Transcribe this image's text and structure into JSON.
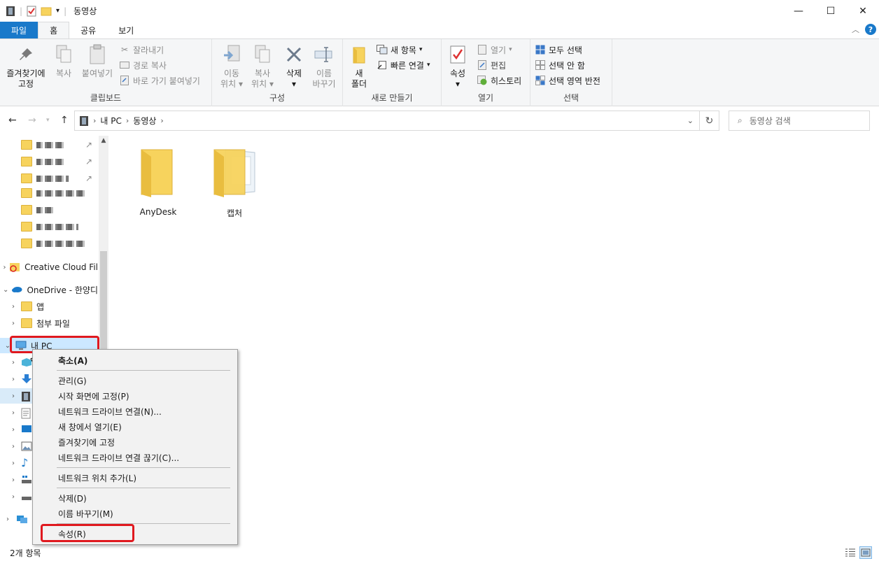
{
  "window": {
    "title": "동영상",
    "buttons": {
      "minimize": "—",
      "maximize": "☐",
      "close": "✕"
    }
  },
  "ribbon_tabs": [
    "파일",
    "홈",
    "공유",
    "보기"
  ],
  "ribbon": {
    "clipboard": {
      "label": "클립보드",
      "pin_label_1": "즐겨찾기에",
      "pin_label_2": "고정",
      "copy": "복사",
      "paste": "붙여넣기",
      "cut": "잘라내기",
      "copy_path": "경로 복사",
      "paste_shortcut": "바로 가기 붙여넣기"
    },
    "organize": {
      "label": "구성",
      "move_1": "이동",
      "move_2": "위치",
      "copy_1": "복사",
      "copy_2": "위치",
      "delete": "삭제",
      "rename_1": "이름",
      "rename_2": "바꾸기"
    },
    "new": {
      "label": "새로 만들기",
      "new_folder_1": "새",
      "new_folder_2": "폴더",
      "new_item": "새 항목",
      "easy_access": "빠른 연결"
    },
    "open": {
      "label": "열기",
      "properties": "속성",
      "open": "열기",
      "edit": "편집",
      "history": "히스토리"
    },
    "select": {
      "label": "선택",
      "select_all": "모두 선택",
      "select_none": "선택 안 함",
      "invert": "선택 영역 반전"
    }
  },
  "address": {
    "crumbs": [
      "내 PC",
      "동영상"
    ],
    "search_placeholder": "동영상 검색"
  },
  "navpane": {
    "creative_cloud": "Creative Cloud Fil",
    "onedrive": "OneDrive - 한양디",
    "app": "앱",
    "attachments": "첨부 파일",
    "this_pc": "내 PC"
  },
  "files": [
    {
      "name": "AnyDesk"
    },
    {
      "name": "캡처"
    }
  ],
  "context_menu": {
    "collapse": "축소(A)",
    "manage": "관리(G)",
    "pin_start": "시작 화면에 고정(P)",
    "map_drive": "네트워크 드라이브 연결(N)...",
    "open_new_window": "새 창에서 열기(E)",
    "pin_quick": "즐겨찾기에 고정",
    "disconnect_drive": "네트워크 드라이브 연결 끊기(C)...",
    "add_network_location": "네트워크 위치 추가(L)",
    "delete": "삭제(D)",
    "rename": "이름 바꾸기(M)",
    "properties": "속성(R)"
  },
  "status": {
    "count": "2개 항목"
  },
  "colors": {
    "accent": "#1979ca",
    "highlight": "#e0191f",
    "folder": "#f7d35d"
  }
}
